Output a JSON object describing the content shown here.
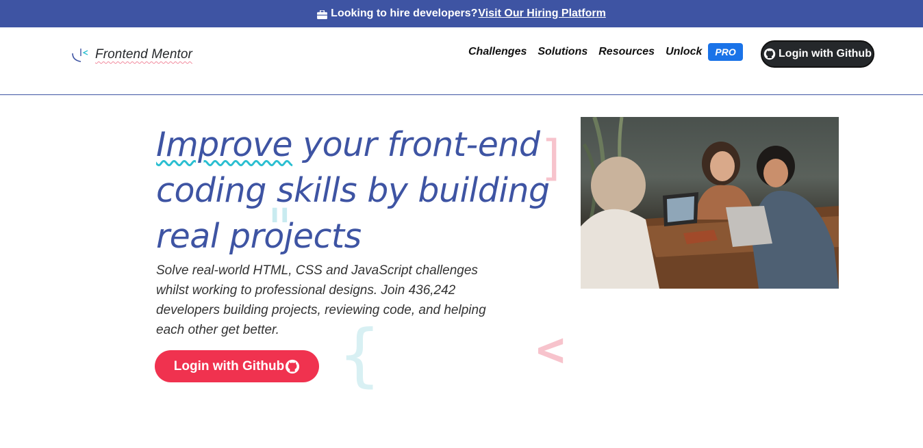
{
  "banner": {
    "icon": "briefcase-icon",
    "text": "Looking to hire developers?",
    "link_label": "Visit Our Hiring Platform"
  },
  "header": {
    "logo_text": "Frontend Mentor",
    "nav": [
      "Challenges",
      "Solutions",
      "Resources",
      "Unlock"
    ],
    "pro_badge": "PRO",
    "login_label": "Login with Github"
  },
  "hero": {
    "title_part1": "Improve",
    "title_part2": " your front-end coding skills by building real projects",
    "description": "Solve real-world HTML, CSS and JavaScript challenges whilst working to professional designs. Join 436,242 developers building projects, reviewing code, and helping each other get better.",
    "login_label": "Login with Github"
  },
  "decorations": [
    "]",
    "\"",
    "{",
    "<"
  ],
  "colors": {
    "brand_blue": "#3e54a3",
    "accent_red": "#f0324f",
    "pro_blue": "#1a73e8",
    "dark": "#25282b",
    "wavy_cyan": "#2bbfd1"
  }
}
